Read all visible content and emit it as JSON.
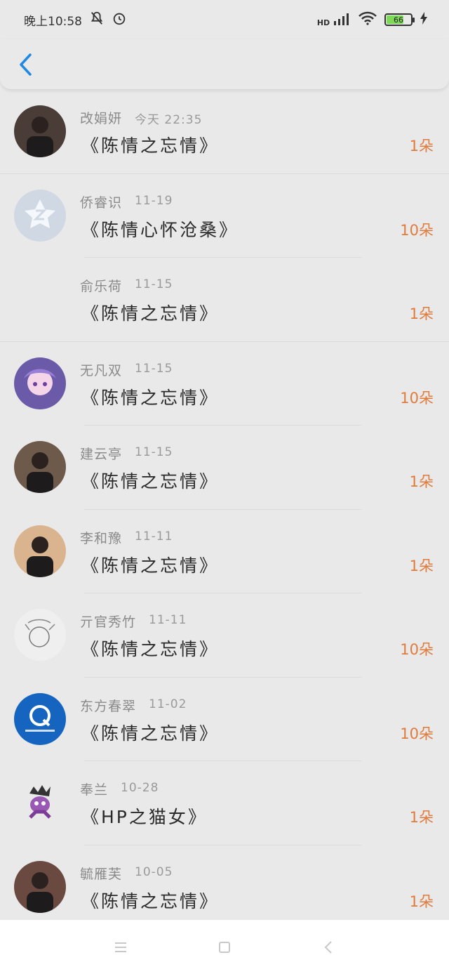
{
  "status_bar": {
    "time": "晚上10:58",
    "signal_label": "HD",
    "battery": "66"
  },
  "list": [
    {
      "name": "改娟妍",
      "date": "今天 22:35",
      "title": "《陈情之忘情》",
      "count": "1朵",
      "avatar_icon": "photo-avatar-icon",
      "avatar_color": "#4a3c36"
    },
    {
      "name": "侨睿识",
      "date": "11-19",
      "title": "《陈情心怀沧桑》",
      "count": "10朵",
      "avatar_icon": "default-qzone-avatar-icon",
      "avatar_color": "#cfd8e3"
    },
    {
      "name": "俞乐荷",
      "date": "11-15",
      "title": "《陈情之忘情》",
      "count": "1朵",
      "avatar_icon": "",
      "avatar_color": "transparent"
    },
    {
      "name": "无凡双",
      "date": "11-15",
      "title": "《陈情之忘情》",
      "count": "10朵",
      "avatar_icon": "anime-avatar-icon",
      "avatar_color": "#6b5aa8"
    },
    {
      "name": "建云亭",
      "date": "11-15",
      "title": "《陈情之忘情》",
      "count": "1朵",
      "avatar_icon": "photo-avatar-icon",
      "avatar_color": "#6e5a4a"
    },
    {
      "name": "李和豫",
      "date": "11-11",
      "title": "《陈情之忘情》",
      "count": "1朵",
      "avatar_icon": "photo-avatar-icon",
      "avatar_color": "#d9b48f"
    },
    {
      "name": "亓官秀竹",
      "date": "11-11",
      "title": "《陈情之忘情》",
      "count": "10朵",
      "avatar_icon": "sketch-avatar-icon",
      "avatar_color": "#efefef"
    },
    {
      "name": "东方春翠",
      "date": "11-02",
      "title": "《陈情之忘情》",
      "count": "10朵",
      "avatar_icon": "q-logo-avatar-icon",
      "avatar_color": "#1565c0"
    },
    {
      "name": "奉兰",
      "date": "10-28",
      "title": "《HP之猫女》",
      "count": "1朵",
      "avatar_icon": "cartoon-avatar-icon",
      "avatar_color": "#e9e9e9"
    },
    {
      "name": "毓雁芙",
      "date": "10-05",
      "title": "《陈情之忘情》",
      "count": "1朵",
      "avatar_icon": "photo-avatar-icon",
      "avatar_color": "#6a4a40"
    }
  ],
  "colors": {
    "accent_blue": "#1e88e5",
    "count_orange": "#e07b3c"
  }
}
